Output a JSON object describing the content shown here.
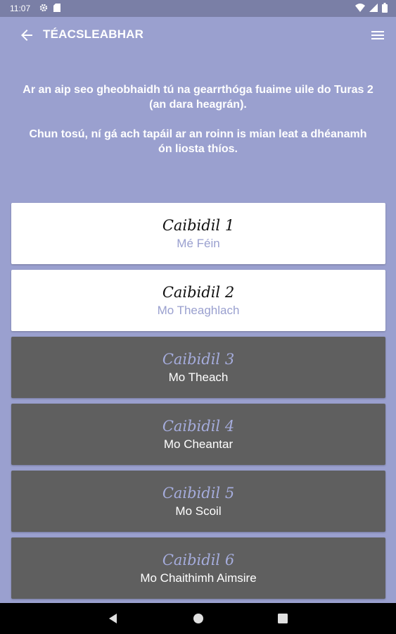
{
  "status_bar": {
    "time": "11:07",
    "icons": [
      "settings-icon",
      "sd-card-icon",
      "wifi-icon",
      "signal-icon",
      "battery-icon"
    ]
  },
  "app_bar": {
    "title": "TÉACSLEABHAR",
    "back_icon": "arrow-back-icon",
    "menu_icon": "hamburger-menu-icon"
  },
  "intro": {
    "line1": "Ar an aip seo gheobhaidh tú na gearrthóga fuaime uile do Turas 2 (an dara heagrán).",
    "line2": "Chun tosú, ní gá ach tapáil ar an roinn is mian leat a dhéanamh ón liosta thíos."
  },
  "chapters": [
    {
      "title": "Caibidil 1",
      "subtitle": "Mé Féin",
      "style": "light"
    },
    {
      "title": "Caibidil 2",
      "subtitle": "Mo Theaghlach",
      "style": "light"
    },
    {
      "title": "Caibidil 3",
      "subtitle": "Mo Theach",
      "style": "dark"
    },
    {
      "title": "Caibidil 4",
      "subtitle": "Mo Cheantar",
      "style": "dark"
    },
    {
      "title": "Caibidil 5",
      "subtitle": "Mo Scoil",
      "style": "dark"
    },
    {
      "title": "Caibidil 6",
      "subtitle": "Mo Chaithimh Aimsire",
      "style": "dark"
    }
  ],
  "nav_bar": {
    "buttons": [
      "back-triangle-icon",
      "home-circle-icon",
      "recents-square-icon"
    ]
  },
  "colors": {
    "background": "#9aa0cf",
    "status_bar": "#7a7fa6",
    "card_light": "#ffffff",
    "card_dark": "#5f5f5f",
    "accent_text": "#a5acdc"
  }
}
